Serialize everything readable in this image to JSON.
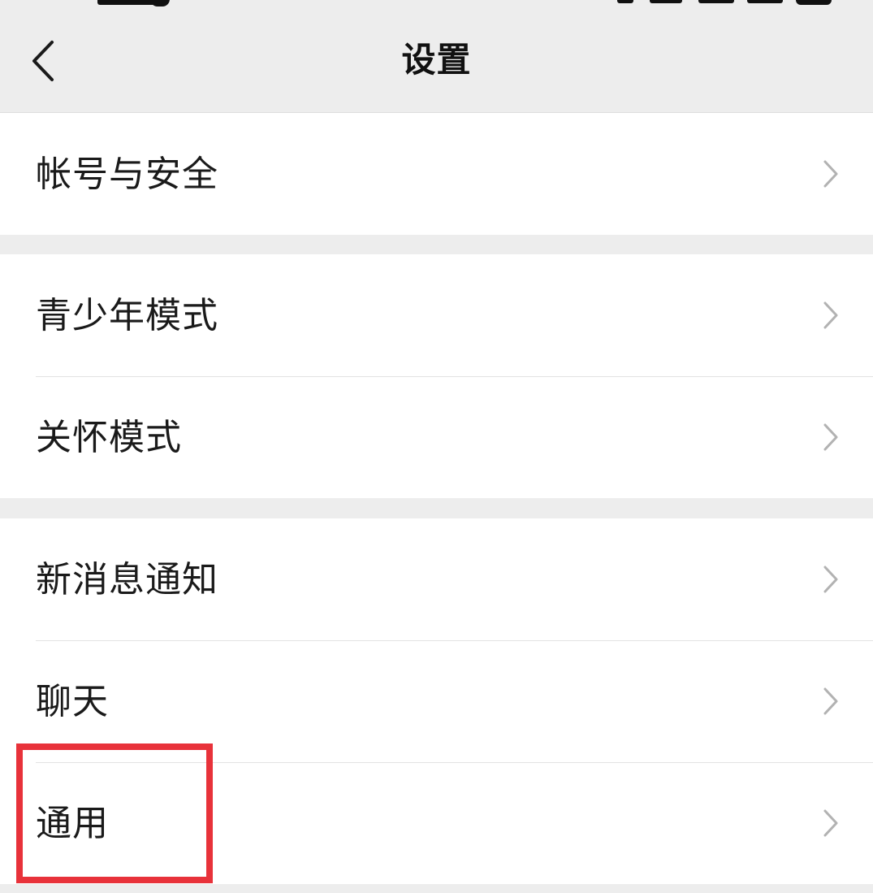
{
  "header": {
    "title": "设置"
  },
  "groups": [
    {
      "items": [
        {
          "label": "帐号与安全"
        }
      ]
    },
    {
      "items": [
        {
          "label": "青少年模式"
        },
        {
          "label": "关怀模式"
        }
      ]
    },
    {
      "items": [
        {
          "label": "新消息通知"
        },
        {
          "label": "聊天"
        },
        {
          "label": "通用"
        }
      ]
    }
  ],
  "icons": {
    "back": "chevron-left-icon",
    "row_arrow": "chevron-right-icon"
  },
  "colors": {
    "background": "#ededed",
    "row_background": "#ffffff",
    "highlight": "#e8323a",
    "chevron": "#b2b2b2"
  }
}
